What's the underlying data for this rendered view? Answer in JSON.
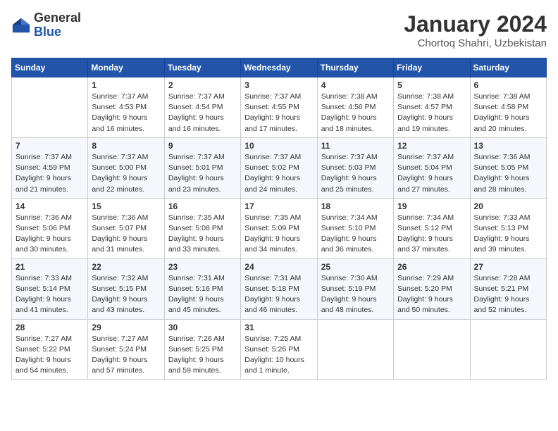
{
  "logo": {
    "general": "General",
    "blue": "Blue"
  },
  "title": {
    "month_year": "January 2024",
    "location": "Chortoq Shahri, Uzbekistan"
  },
  "weekdays": [
    "Sunday",
    "Monday",
    "Tuesday",
    "Wednesday",
    "Thursday",
    "Friday",
    "Saturday"
  ],
  "weeks": [
    [
      {
        "day": "",
        "info": ""
      },
      {
        "day": "1",
        "info": "Sunrise: 7:37 AM\nSunset: 4:53 PM\nDaylight: 9 hours\nand 16 minutes."
      },
      {
        "day": "2",
        "info": "Sunrise: 7:37 AM\nSunset: 4:54 PM\nDaylight: 9 hours\nand 16 minutes."
      },
      {
        "day": "3",
        "info": "Sunrise: 7:37 AM\nSunset: 4:55 PM\nDaylight: 9 hours\nand 17 minutes."
      },
      {
        "day": "4",
        "info": "Sunrise: 7:38 AM\nSunset: 4:56 PM\nDaylight: 9 hours\nand 18 minutes."
      },
      {
        "day": "5",
        "info": "Sunrise: 7:38 AM\nSunset: 4:57 PM\nDaylight: 9 hours\nand 19 minutes."
      },
      {
        "day": "6",
        "info": "Sunrise: 7:38 AM\nSunset: 4:58 PM\nDaylight: 9 hours\nand 20 minutes."
      }
    ],
    [
      {
        "day": "7",
        "info": "Sunrise: 7:37 AM\nSunset: 4:59 PM\nDaylight: 9 hours\nand 21 minutes."
      },
      {
        "day": "8",
        "info": "Sunrise: 7:37 AM\nSunset: 5:00 PM\nDaylight: 9 hours\nand 22 minutes."
      },
      {
        "day": "9",
        "info": "Sunrise: 7:37 AM\nSunset: 5:01 PM\nDaylight: 9 hours\nand 23 minutes."
      },
      {
        "day": "10",
        "info": "Sunrise: 7:37 AM\nSunset: 5:02 PM\nDaylight: 9 hours\nand 24 minutes."
      },
      {
        "day": "11",
        "info": "Sunrise: 7:37 AM\nSunset: 5:03 PM\nDaylight: 9 hours\nand 25 minutes."
      },
      {
        "day": "12",
        "info": "Sunrise: 7:37 AM\nSunset: 5:04 PM\nDaylight: 9 hours\nand 27 minutes."
      },
      {
        "day": "13",
        "info": "Sunrise: 7:36 AM\nSunset: 5:05 PM\nDaylight: 9 hours\nand 28 minutes."
      }
    ],
    [
      {
        "day": "14",
        "info": "Sunrise: 7:36 AM\nSunset: 5:06 PM\nDaylight: 9 hours\nand 30 minutes."
      },
      {
        "day": "15",
        "info": "Sunrise: 7:36 AM\nSunset: 5:07 PM\nDaylight: 9 hours\nand 31 minutes."
      },
      {
        "day": "16",
        "info": "Sunrise: 7:35 AM\nSunset: 5:08 PM\nDaylight: 9 hours\nand 33 minutes."
      },
      {
        "day": "17",
        "info": "Sunrise: 7:35 AM\nSunset: 5:09 PM\nDaylight: 9 hours\nand 34 minutes."
      },
      {
        "day": "18",
        "info": "Sunrise: 7:34 AM\nSunset: 5:10 PM\nDaylight: 9 hours\nand 36 minutes."
      },
      {
        "day": "19",
        "info": "Sunrise: 7:34 AM\nSunset: 5:12 PM\nDaylight: 9 hours\nand 37 minutes."
      },
      {
        "day": "20",
        "info": "Sunrise: 7:33 AM\nSunset: 5:13 PM\nDaylight: 9 hours\nand 39 minutes."
      }
    ],
    [
      {
        "day": "21",
        "info": "Sunrise: 7:33 AM\nSunset: 5:14 PM\nDaylight: 9 hours\nand 41 minutes."
      },
      {
        "day": "22",
        "info": "Sunrise: 7:32 AM\nSunset: 5:15 PM\nDaylight: 9 hours\nand 43 minutes."
      },
      {
        "day": "23",
        "info": "Sunrise: 7:31 AM\nSunset: 5:16 PM\nDaylight: 9 hours\nand 45 minutes."
      },
      {
        "day": "24",
        "info": "Sunrise: 7:31 AM\nSunset: 5:18 PM\nDaylight: 9 hours\nand 46 minutes."
      },
      {
        "day": "25",
        "info": "Sunrise: 7:30 AM\nSunset: 5:19 PM\nDaylight: 9 hours\nand 48 minutes."
      },
      {
        "day": "26",
        "info": "Sunrise: 7:29 AM\nSunset: 5:20 PM\nDaylight: 9 hours\nand 50 minutes."
      },
      {
        "day": "27",
        "info": "Sunrise: 7:28 AM\nSunset: 5:21 PM\nDaylight: 9 hours\nand 52 minutes."
      }
    ],
    [
      {
        "day": "28",
        "info": "Sunrise: 7:27 AM\nSunset: 5:22 PM\nDaylight: 9 hours\nand 54 minutes."
      },
      {
        "day": "29",
        "info": "Sunrise: 7:27 AM\nSunset: 5:24 PM\nDaylight: 9 hours\nand 57 minutes."
      },
      {
        "day": "30",
        "info": "Sunrise: 7:26 AM\nSunset: 5:25 PM\nDaylight: 9 hours\nand 59 minutes."
      },
      {
        "day": "31",
        "info": "Sunrise: 7:25 AM\nSunset: 5:26 PM\nDaylight: 10 hours\nand 1 minute."
      },
      {
        "day": "",
        "info": ""
      },
      {
        "day": "",
        "info": ""
      },
      {
        "day": "",
        "info": ""
      }
    ]
  ]
}
